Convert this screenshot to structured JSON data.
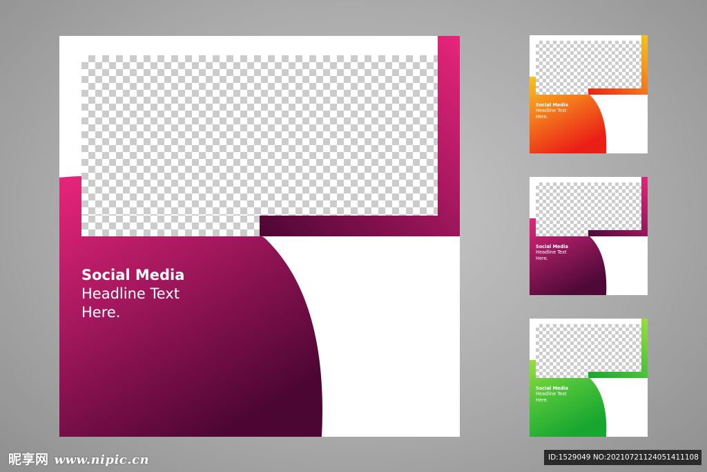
{
  "templates": [
    {
      "id": "main",
      "headline": [
        "Social Media",
        "Headline Text",
        "Here."
      ],
      "colors": {
        "light": "#e8257a",
        "mid": "#a4175e",
        "dark": "#4c0633"
      }
    },
    {
      "id": "orange",
      "headline": [
        "Social Media",
        "Headline Text",
        "Here."
      ],
      "colors": {
        "light": "#f7c51c",
        "mid": "#f47d1c",
        "dark": "#ea1f16"
      }
    },
    {
      "id": "magenta",
      "headline": [
        "Social Media",
        "Headline Text",
        "Here."
      ],
      "colors": {
        "light": "#e4267a",
        "mid": "#9a1a5e",
        "dark": "#4e0938"
      }
    },
    {
      "id": "green",
      "headline": [
        "Social Media",
        "Headline Text",
        "Here."
      ],
      "colors": {
        "light": "#9be03a",
        "mid": "#4fc43a",
        "dark": "#17a62f"
      }
    }
  ],
  "watermark": {
    "logo": "昵享网",
    "url": "www.nipic.cn",
    "id_text": "ID:1529049 NO:20210721124051411108"
  }
}
